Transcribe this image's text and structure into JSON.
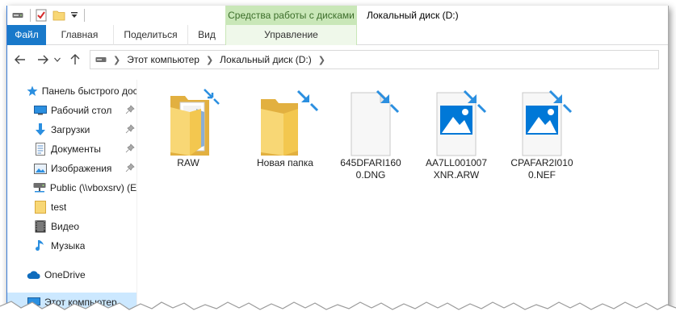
{
  "qat": {
    "items": [
      "drive-icon",
      "properties-check-icon",
      "new-folder-icon",
      "customize-dropdown-icon"
    ]
  },
  "title": {
    "context_group": "Средства работы с дисками",
    "window_title": "Локальный диск (D:)"
  },
  "ribbon": {
    "tabs": [
      {
        "label": "Файл"
      },
      {
        "label": "Главная"
      },
      {
        "label": "Поделиться"
      },
      {
        "label": "Вид"
      },
      {
        "label": "Управление"
      }
    ]
  },
  "address": {
    "crumbs": [
      "Этот компьютер",
      "Локальный диск (D:)"
    ]
  },
  "sidebar": {
    "items": [
      {
        "label": "Панель быстрого доступа",
        "icon": "star-icon",
        "pinned": false
      },
      {
        "label": "Рабочий стол",
        "icon": "desktop-icon",
        "pinned": true
      },
      {
        "label": "Загрузки",
        "icon": "download-arrow-icon",
        "pinned": true
      },
      {
        "label": "Документы",
        "icon": "documents-icon",
        "pinned": true
      },
      {
        "label": "Изображения",
        "icon": "pictures-icon",
        "pinned": true
      },
      {
        "label": "Public (\\\\vboxsrv) (E:)",
        "icon": "network-drive-icon",
        "pinned": false
      },
      {
        "label": "test",
        "icon": "folder-icon",
        "pinned": false
      },
      {
        "label": "Видео",
        "icon": "video-icon",
        "pinned": false
      },
      {
        "label": "Музыка",
        "icon": "music-icon",
        "pinned": false
      },
      {
        "label": "OneDrive",
        "icon": "cloud-icon",
        "pinned": false
      },
      {
        "label": "Этот компьютер",
        "icon": "computer-icon",
        "pinned": false
      }
    ]
  },
  "files": [
    {
      "name": "RAW",
      "type": "folder-with-files"
    },
    {
      "name": "Новая папка",
      "type": "folder"
    },
    {
      "name": "645DFARI1600.DNG",
      "type": "file"
    },
    {
      "name": "AA7LL001007XNR.ARW",
      "type": "image"
    },
    {
      "name": "CPAFAR2I0100.NEF",
      "type": "image"
    }
  ],
  "colors": {
    "accent": "#1979ca",
    "context_tab": "#c9e7b8",
    "selection": "#cce8ff",
    "folder": "#f8d775",
    "image_blue": "#0078d7"
  }
}
